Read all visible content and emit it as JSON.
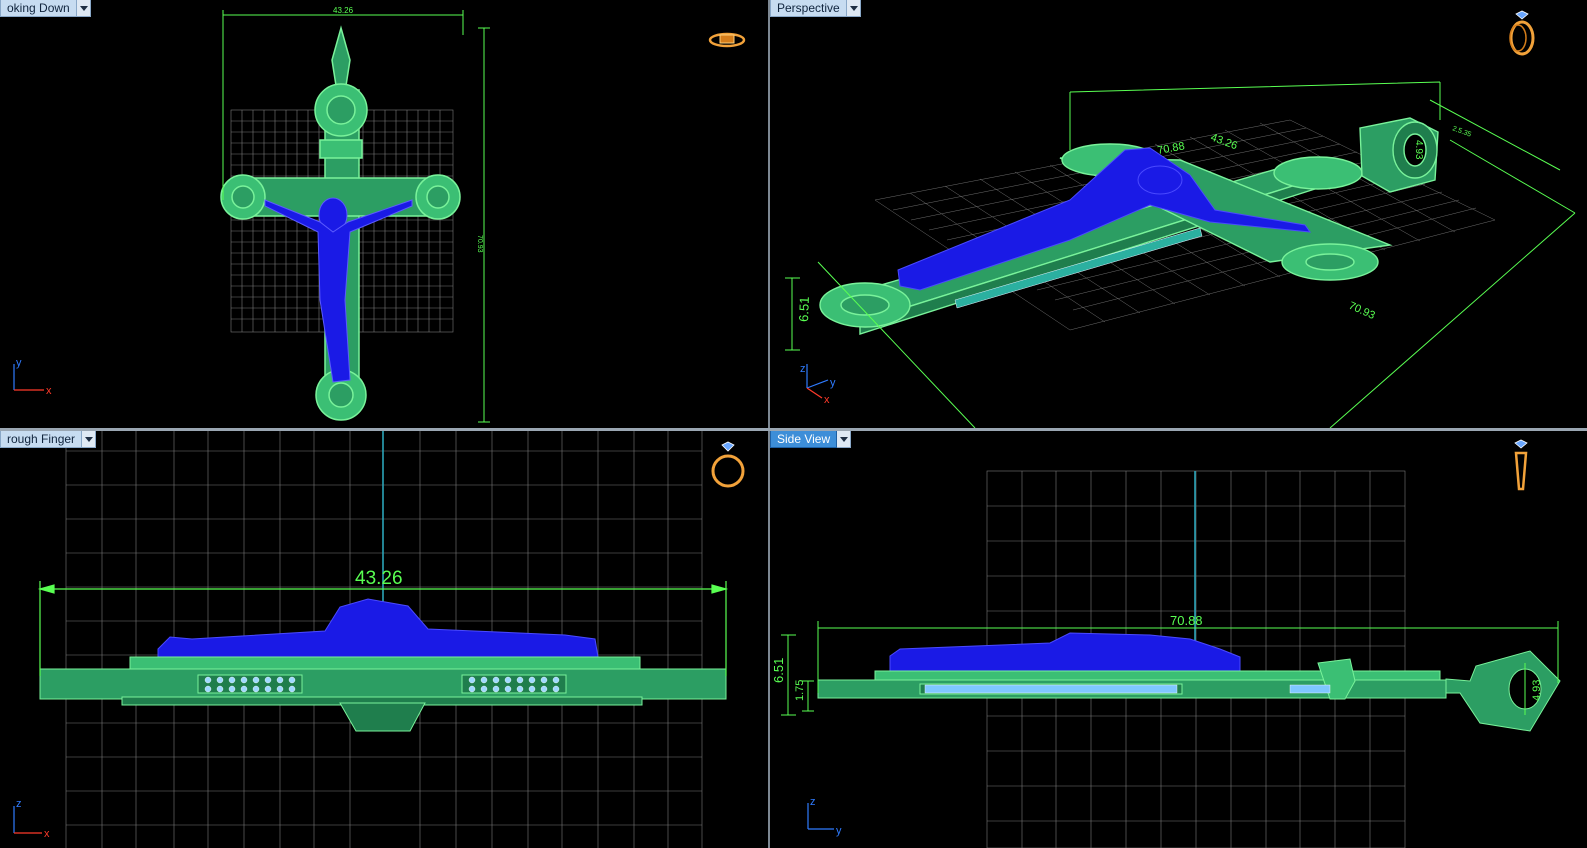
{
  "viewports": {
    "top_left": {
      "tab_label": "oking Down",
      "active": false
    },
    "top_right": {
      "tab_label": "Perspective",
      "active": false
    },
    "bottom_left": {
      "tab_label": "rough Finger",
      "active": false
    },
    "bottom_right": {
      "tab_label": "Side View",
      "active": true
    }
  },
  "dimensions": {
    "top_left": {
      "width": "43.26",
      "height": "70.93"
    },
    "top_right": {
      "length": "70.88",
      "width": "43.26",
      "height": "6.51",
      "side": "70.93",
      "ring": "4.93",
      "ring_extra": "2.5.35"
    },
    "bottom_left": {
      "width": "43.26"
    },
    "bottom_right": {
      "length": "70.88",
      "height": "6.51",
      "thickness": "1.75",
      "bail": "4.93"
    }
  },
  "axes": {
    "top_left": {
      "a": "y",
      "b": "x"
    },
    "top_right": {
      "a": "z",
      "b": "y",
      "c": "x"
    },
    "bottom_left": {
      "a": "z",
      "b": "x"
    },
    "bottom_right": {
      "a": "z",
      "b": "y"
    }
  },
  "colors": {
    "model_green": "#2fa86a",
    "model_blue": "#1616e0",
    "dimension": "#59ff52",
    "grid": "#8a8a8a",
    "tab_active": "#3d8ed8",
    "tab_inactive": "#c7dcf1"
  },
  "icons": {
    "top_left": "ring-top-icon",
    "top_right": "ring-perspective-icon",
    "bottom_left": "ring-front-icon",
    "bottom_right": "ring-side-icon"
  }
}
